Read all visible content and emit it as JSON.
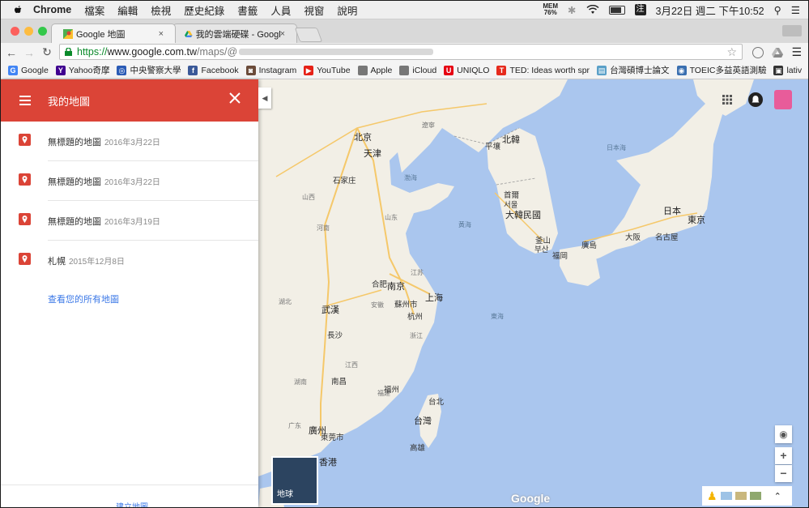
{
  "menubar": {
    "items": [
      "Chrome",
      "檔案",
      "編輯",
      "檢視",
      "歷史紀錄",
      "書籤",
      "人員",
      "視窗",
      "說明"
    ],
    "mem_label": "MEM",
    "mem_value": "76%",
    "ime": "注",
    "clock": "3月22日 週二 下午10:52"
  },
  "tabs": [
    {
      "title": "Google 地圖",
      "close": "×"
    },
    {
      "title": "我的雲端硬碟 - Google 雲端",
      "close": "×"
    }
  ],
  "toolbar": {
    "url_scheme": "https://",
    "url_host": "www.google.com.tw",
    "url_path": "/maps/@"
  },
  "bookmarks": [
    {
      "label": "Google",
      "icon": "google-icon",
      "color": "#4285f4",
      "glyph": "G"
    },
    {
      "label": "Yahoo奇摩",
      "icon": "yahoo-icon",
      "color": "#400090",
      "glyph": "Y"
    },
    {
      "label": "中央警察大學",
      "icon": "cpu-icon",
      "color": "#2a5bb5",
      "glyph": "◎"
    },
    {
      "label": "Facebook",
      "icon": "facebook-icon",
      "color": "#3b5998",
      "glyph": "f"
    },
    {
      "label": "Instagram",
      "icon": "instagram-icon",
      "color": "#6b4b3a",
      "glyph": "◙"
    },
    {
      "label": "YouTube",
      "icon": "youtube-icon",
      "color": "#e62117",
      "glyph": "▶"
    },
    {
      "label": "Apple",
      "icon": "apple-icon",
      "color": "#777777",
      "glyph": ""
    },
    {
      "label": "iCloud",
      "icon": "apple-icon",
      "color": "#777777",
      "glyph": ""
    },
    {
      "label": "UNIQLO",
      "icon": "uniqlo-icon",
      "color": "#e60012",
      "glyph": "U"
    },
    {
      "label": "TED: Ideas worth spr",
      "icon": "ted-icon",
      "color": "#e62b1e",
      "glyph": "T"
    },
    {
      "label": "台灣碩博士論文",
      "icon": "thesis-icon",
      "color": "#5aa0c8",
      "glyph": "▤"
    },
    {
      "label": "TOEIC多益英語測驗",
      "icon": "toeic-icon",
      "color": "#3a6fb0",
      "glyph": "◉"
    },
    {
      "label": "lativ",
      "icon": "lativ-icon",
      "color": "#333333",
      "glyph": "▣"
    }
  ],
  "panel": {
    "title": "我的地圖",
    "maps": [
      {
        "name": "無標題的地圖",
        "date": "2016年3月22日"
      },
      {
        "name": "無標題的地圖",
        "date": "2016年3月22日"
      },
      {
        "name": "無標題的地圖",
        "date": "2016年3月19日"
      },
      {
        "name": "札幌",
        "date": "2015年12月8日"
      }
    ],
    "view_all": "查看您的所有地圖",
    "create": "建立地圖"
  },
  "map": {
    "earth_label": "地球",
    "logo": "Google",
    "labels": [
      {
        "text": "北京",
        "cls": "big"
      },
      {
        "text": "天津",
        "cls": "big"
      },
      {
        "text": "石家庄",
        "cls": ""
      },
      {
        "text": "山西",
        "cls": "prov"
      },
      {
        "text": "山东",
        "cls": "prov"
      },
      {
        "text": "河南",
        "cls": "prov"
      },
      {
        "text": "江苏",
        "cls": "prov"
      },
      {
        "text": "安徽",
        "cls": "prov"
      },
      {
        "text": "湖北",
        "cls": "prov"
      },
      {
        "text": "浙江",
        "cls": "prov"
      },
      {
        "text": "江西",
        "cls": "prov"
      },
      {
        "text": "湖南",
        "cls": "prov"
      },
      {
        "text": "福建",
        "cls": "prov"
      },
      {
        "text": "广东",
        "cls": "prov"
      },
      {
        "text": "南京",
        "cls": "big"
      },
      {
        "text": "蘇州市",
        "cls": ""
      },
      {
        "text": "上海",
        "cls": "big"
      },
      {
        "text": "杭州",
        "cls": ""
      },
      {
        "text": "合肥",
        "cls": ""
      },
      {
        "text": "武漢",
        "cls": "big"
      },
      {
        "text": "南昌",
        "cls": ""
      },
      {
        "text": "長沙",
        "cls": ""
      },
      {
        "text": "福州",
        "cls": ""
      },
      {
        "text": "廣州",
        "cls": "big"
      },
      {
        "text": "東莞市",
        "cls": ""
      },
      {
        "text": "香港",
        "cls": "big"
      },
      {
        "text": "台北",
        "cls": ""
      },
      {
        "text": "台灣",
        "cls": "big"
      },
      {
        "text": "高雄",
        "cls": ""
      },
      {
        "text": "北韓",
        "cls": "big"
      },
      {
        "text": "平壤",
        "cls": ""
      },
      {
        "text": "首爾",
        "cls": ""
      },
      {
        "text": "서울",
        "cls": ""
      },
      {
        "text": "大韓民國",
        "cls": "big"
      },
      {
        "text": "釜山",
        "cls": ""
      },
      {
        "text": "부산",
        "cls": ""
      },
      {
        "text": "福岡",
        "cls": ""
      },
      {
        "text": "廣島",
        "cls": ""
      },
      {
        "text": "大阪",
        "cls": ""
      },
      {
        "text": "名古屋",
        "cls": ""
      },
      {
        "text": "東京",
        "cls": "big"
      },
      {
        "text": "日本",
        "cls": "big"
      },
      {
        "text": "黃海",
        "cls": "sea"
      },
      {
        "text": "東海",
        "cls": "sea"
      },
      {
        "text": "日本海",
        "cls": "sea"
      },
      {
        "text": "渤海",
        "cls": "sea"
      },
      {
        "text": "遼寧",
        "cls": "prov"
      }
    ]
  }
}
